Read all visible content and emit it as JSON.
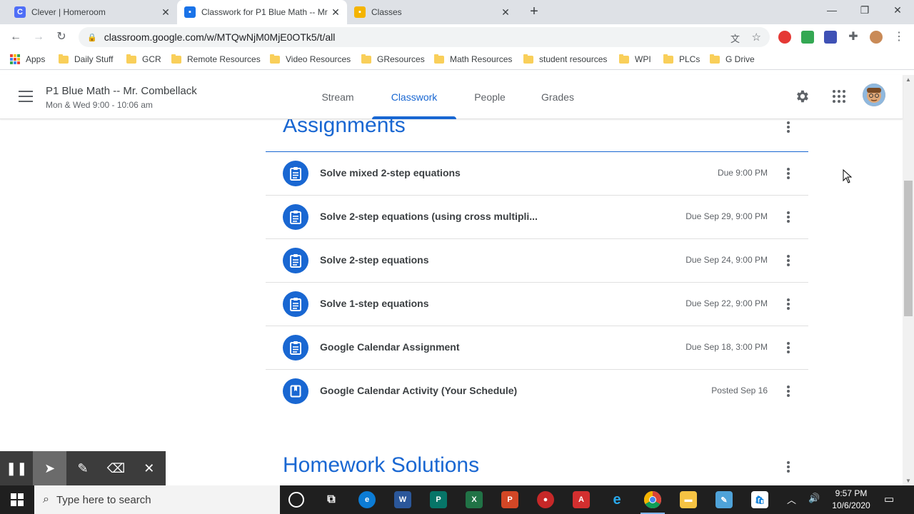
{
  "browser": {
    "tabs": [
      {
        "title": "Clever | Homeroom",
        "favicon": "clever-icon",
        "active": false
      },
      {
        "title": "Classwork for P1 Blue Math -- Mr",
        "favicon": "classroom-icon",
        "active": true
      },
      {
        "title": "Classes",
        "favicon": "classes-icon",
        "active": false
      }
    ],
    "url": "classroom.google.com/w/MTQwNjM0MjE0OTk5/t/all",
    "bookmarks": [
      "Apps",
      "Daily Stuff",
      "GCR",
      "Remote Resources",
      "Video Resources",
      "GResources",
      "Math Resources",
      "student resources",
      "WPI",
      "PLCs",
      "G Drive"
    ]
  },
  "classroom": {
    "class_name": "P1 Blue Math -- Mr. Combellack",
    "schedule": "Mon & Wed 9:00 - 10:06 am",
    "nav_tabs": [
      "Stream",
      "Classwork",
      "People",
      "Grades"
    ],
    "active_tab": "Classwork"
  },
  "sections": {
    "assignments_title": "Assignments",
    "homework_title": "Homework Solutions"
  },
  "assignments": [
    {
      "title": "Solve mixed 2-step equations",
      "due": "Due 9:00 PM",
      "icon": "assignment-icon"
    },
    {
      "title": "Solve 2-step equations (using cross multipli...",
      "due": "Due Sep 29, 9:00 PM",
      "icon": "assignment-icon"
    },
    {
      "title": "Solve 2-step equations",
      "due": "Due Sep 24, 9:00 PM",
      "icon": "assignment-icon"
    },
    {
      "title": "Solve 1-step equations",
      "due": "Due Sep 22, 9:00 PM",
      "icon": "assignment-icon"
    },
    {
      "title": "Google Calendar Assignment",
      "due": "Due Sep 18, 3:00 PM",
      "icon": "assignment-icon"
    },
    {
      "title": "Google Calendar Activity (Your Schedule)",
      "due": "Posted Sep 16",
      "icon": "material-icon"
    }
  ],
  "taskbar": {
    "search_placeholder": "Type here to search",
    "time": "9:57 PM",
    "date": "10/6/2020"
  },
  "colors": {
    "accent": "#1967d2",
    "text": "#3c4043",
    "muted": "#5f6368"
  }
}
